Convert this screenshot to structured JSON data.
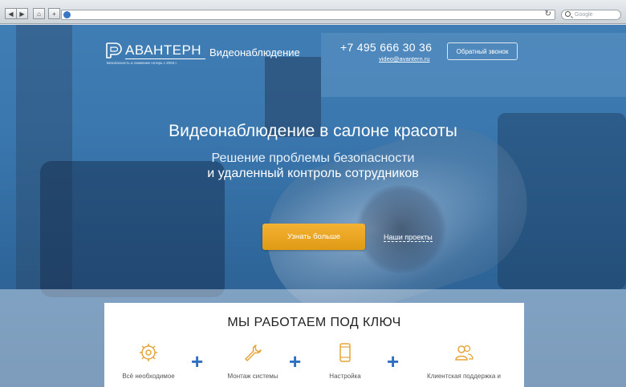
{
  "browser": {
    "search_placeholder": "Google",
    "back_label": "◀",
    "forward_label": "▶",
    "home_label": "⌂",
    "add_label": "+",
    "reload_label": "↻"
  },
  "header": {
    "logo_text": "АВАНТЕРН",
    "logo_tagline": "Безопасность и снижение потерь с 2004 г.",
    "section": "Видеонаблюдение",
    "phone": "+7 495 666 30 36",
    "email": "video@avantern.ru",
    "callback_label": "Обратный звонок"
  },
  "hero": {
    "title": "Видеонаблюдение в салоне красоты",
    "subtitle_line1": "Решение проблемы безопасности",
    "subtitle_line2": "и удаленный контроль сотрудников",
    "cta_label": "Узнать больше",
    "projects_label": "Наши проекты"
  },
  "card": {
    "title": "МЫ РАБОТАЕМ ПОД КЛЮЧ",
    "steps": [
      {
        "label": "Всё необходимое",
        "icon": "gear-icon"
      },
      {
        "label": "Монтаж системы",
        "icon": "wrench-icon"
      },
      {
        "label": "Настройка",
        "icon": "phone-icon"
      },
      {
        "label": "Клиентская поддержка и",
        "icon": "users-icon"
      }
    ],
    "plus": "+"
  },
  "colors": {
    "accent_orange": "#eea524",
    "accent_blue": "#2e6fc0",
    "icon_gold": "#e6a53a"
  }
}
